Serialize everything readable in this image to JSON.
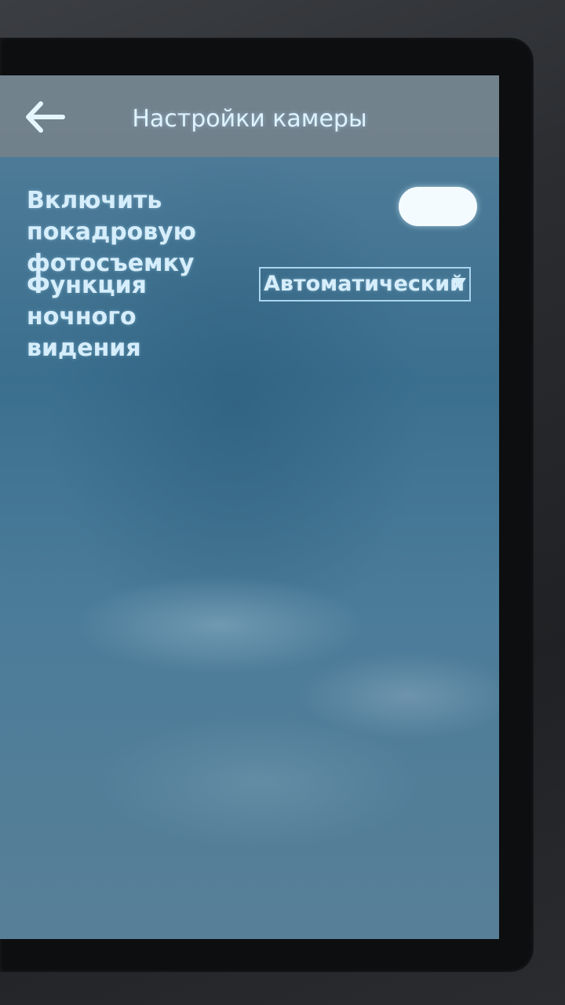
{
  "header": {
    "title": "Настройки камеры",
    "back_icon": "arrow-left-icon"
  },
  "settings": {
    "frame_by_frame": {
      "label": "Включить покадровую фотосъемку",
      "enabled": true
    },
    "night_vision": {
      "label": "Функция ночного видения",
      "value": "Автоматический",
      "icon": "dropdown-caret-icon"
    }
  },
  "colors": {
    "text": "#d6eefc",
    "screen_bg": "#3f6e8c",
    "title_bar": "#78828a",
    "toggle": "#f4fbff"
  }
}
